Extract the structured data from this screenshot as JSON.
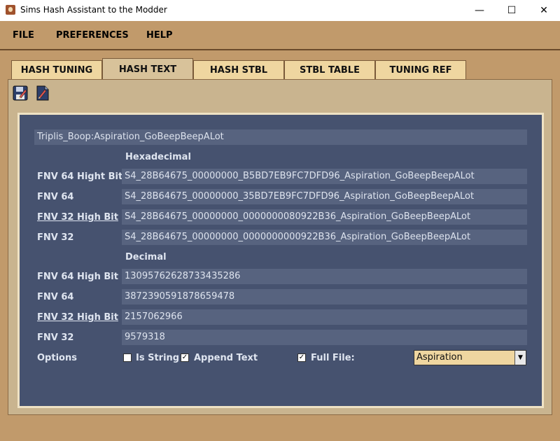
{
  "window": {
    "title": "Sims Hash Assistant to the Modder",
    "controls": {
      "minimize": "—",
      "maximize": "☐",
      "close": "✕"
    }
  },
  "menu": [
    "FILE",
    "PREFERENCES",
    "HELP"
  ],
  "tabs": [
    {
      "label": "HASH TUNING",
      "active": false
    },
    {
      "label": "HASH TEXT",
      "active": true
    },
    {
      "label": "HASH STBL",
      "active": false
    },
    {
      "label": "STBL TABLE",
      "active": false
    },
    {
      "label": "TUNING REF",
      "active": false
    }
  ],
  "toolbar": {
    "icons": [
      "save-icon",
      "edit-file-icon"
    ]
  },
  "input_text": "Triplis_Boop:Aspiration_GoBeepBeepALot",
  "hex": {
    "heading": "Hexadecimal",
    "rows": [
      {
        "label": "FNV 64 Hight Bit",
        "value": "S4_28B64675_00000000_B5BD7EB9FC7DFD96_Aspiration_GoBeepBeepALot"
      },
      {
        "label": "FNV 64",
        "value": "S4_28B64675_00000000_35BD7EB9FC7DFD96_Aspiration_GoBeepBeepALot"
      },
      {
        "label": "FNV 32 High Bit",
        "value": "S4_28B64675_00000000_0000000080922B36_Aspiration_GoBeepBeepALot"
      },
      {
        "label": "FNV 32",
        "value": "S4_28B64675_00000000_0000000000922B36_Aspiration_GoBeepBeepALot"
      }
    ]
  },
  "dec": {
    "heading": "Decimal",
    "rows": [
      {
        "label": "FNV 64 High Bit",
        "value": "13095762628733435286"
      },
      {
        "label": "FNV 64",
        "value": "3872390591878659478"
      },
      {
        "label": "FNV 32 High Bit",
        "value": "2157062966"
      },
      {
        "label": "FNV 32",
        "value": "9579318"
      }
    ]
  },
  "options": {
    "label": "Options",
    "is_string": {
      "label": "Is String",
      "checked": false
    },
    "append_text": {
      "label": "Append Text",
      "checked": true
    },
    "full_file": {
      "label": "Full File:",
      "checked": true
    },
    "dropdown_value": "Aspiration"
  }
}
